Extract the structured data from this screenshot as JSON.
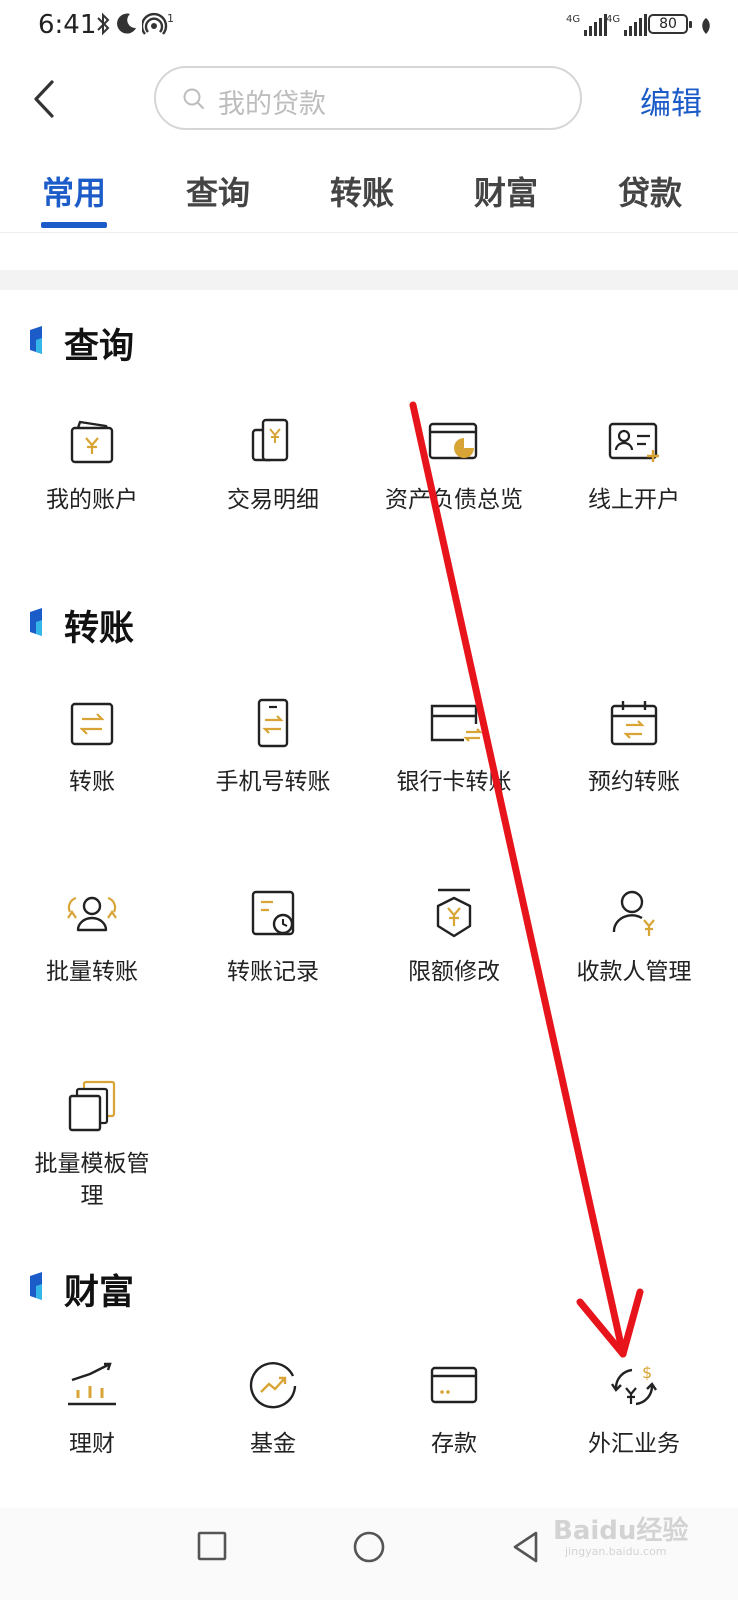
{
  "status_bar": {
    "time": "6:41",
    "hotspot_badge": "1",
    "signal_1_label": "4G",
    "signal_2_label": "4G",
    "battery": "80"
  },
  "header": {
    "search_placeholder": "我的贷款",
    "edit_label": "编辑"
  },
  "tabs": [
    {
      "label": "常用",
      "active": true
    },
    {
      "label": "查询",
      "active": false
    },
    {
      "label": "转账",
      "active": false
    },
    {
      "label": "财富",
      "active": false
    },
    {
      "label": "贷款",
      "active": false
    }
  ],
  "sections": {
    "query": {
      "title": "查询",
      "items": [
        {
          "label": "我的账户",
          "icon": "wallet-yen-icon"
        },
        {
          "label": "交易明细",
          "icon": "transaction-detail-icon"
        },
        {
          "label": "资产负债总览",
          "icon": "asset-overview-icon"
        },
        {
          "label": "线上开户",
          "icon": "id-card-add-icon"
        }
      ]
    },
    "transfer": {
      "title": "转账",
      "items": [
        {
          "label": "转账",
          "icon": "transfer-icon"
        },
        {
          "label": "手机号转账",
          "icon": "phone-transfer-icon"
        },
        {
          "label": "银行卡转账",
          "icon": "bank-card-transfer-icon"
        },
        {
          "label": "预约转账",
          "icon": "scheduled-transfer-icon"
        },
        {
          "label": "批量转账",
          "icon": "batch-transfer-icon"
        },
        {
          "label": "转账记录",
          "icon": "transfer-record-icon"
        },
        {
          "label": "限额修改",
          "icon": "limit-modify-icon"
        },
        {
          "label": "收款人管理",
          "icon": "payee-manage-icon"
        },
        {
          "label": "批量模板管理",
          "icon": "batch-template-icon"
        }
      ]
    },
    "wealth": {
      "title": "财富",
      "items": [
        {
          "label": "理财",
          "icon": "wealth-chart-icon"
        },
        {
          "label": "基金",
          "icon": "fund-icon"
        },
        {
          "label": "存款",
          "icon": "deposit-card-icon"
        },
        {
          "label": "外汇业务",
          "icon": "forex-icon"
        }
      ]
    }
  },
  "watermark": {
    "text": "Baidu经验",
    "sub": "jingyan.baidu.com"
  },
  "colors": {
    "accent": "#1c5cc8",
    "icon_gold": "#d9a436",
    "annotation": "#e8141c"
  }
}
